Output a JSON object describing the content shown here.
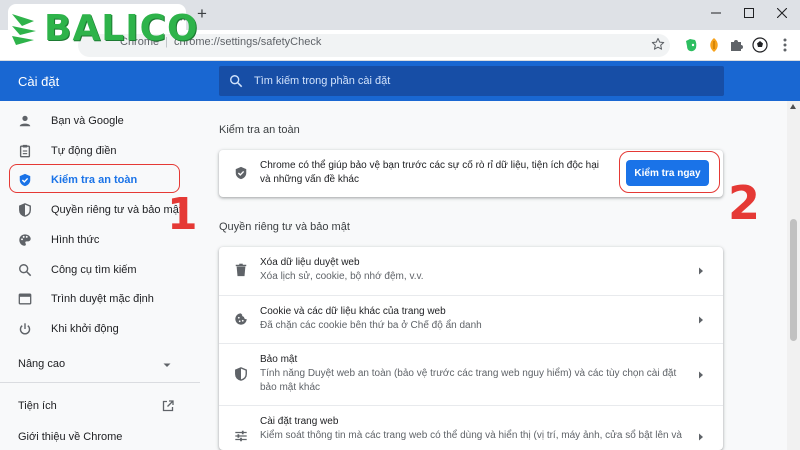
{
  "browser": {
    "url_host": "Chrome",
    "url_path": "chrome://settings/safetyCheck",
    "new_tab": "+",
    "tab_close": "×"
  },
  "logo": {
    "text": "BALICO",
    "color": "#2eb34a"
  },
  "header": {
    "title": "Cài đặt",
    "search_placeholder": "Tìm kiếm trong phần cài đặt",
    "color": "#1967d2"
  },
  "sidebar": {
    "items": [
      {
        "label": "Bạn và Google",
        "icon": "person-icon"
      },
      {
        "label": "Tự động điền",
        "icon": "clipboard-icon"
      },
      {
        "label": "Kiểm tra an toàn",
        "icon": "shield-check-icon",
        "active": true
      },
      {
        "label": "Quyền riêng tư và bảo mật",
        "icon": "shield-icon"
      },
      {
        "label": "Hình thức",
        "icon": "palette-icon"
      },
      {
        "label": "Công cụ tìm kiếm",
        "icon": "search-icon"
      },
      {
        "label": "Trình duyệt mặc định",
        "icon": "browser-icon"
      },
      {
        "label": "Khi khởi động",
        "icon": "power-icon"
      }
    ],
    "advanced": "Nâng cao",
    "extensions": "Tiện ích",
    "about": "Giới thiệu về Chrome"
  },
  "safety_check": {
    "section_title": "Kiểm tra an toàn",
    "description": "Chrome có thể giúp bảo vệ bạn trước các sự cố rò rỉ dữ liệu, tiện ích độc hại và những vấn đề khác",
    "button_label": "Kiểm tra ngay"
  },
  "privacy": {
    "section_title": "Quyền riêng tư và bảo mật",
    "rows": [
      {
        "title": "Xóa dữ liệu duyệt web",
        "desc": "Xóa lịch sử, cookie, bộ nhớ đệm, v.v.",
        "icon": "trash-icon"
      },
      {
        "title": "Cookie và các dữ liệu khác của trang web",
        "desc": "Đã chặn các cookie bên thứ ba ở Chế độ ẩn danh",
        "icon": "cookie-icon"
      },
      {
        "title": "Bảo mật",
        "desc": "Tính năng Duyệt web an toàn (bảo vệ trước các trang web nguy hiểm) và các tùy chọn cài đặt bảo mật khác",
        "icon": "shield-icon"
      },
      {
        "title": "Cài đặt trang web",
        "desc": "Kiểm soát thông tin mà các trang web có thể dùng và hiển thị (vị trí, máy ảnh, cửa sổ bật lên và",
        "icon": "sliders-icon"
      }
    ]
  },
  "annotations": {
    "step1": "1",
    "step2": "2",
    "color": "#e53935"
  }
}
